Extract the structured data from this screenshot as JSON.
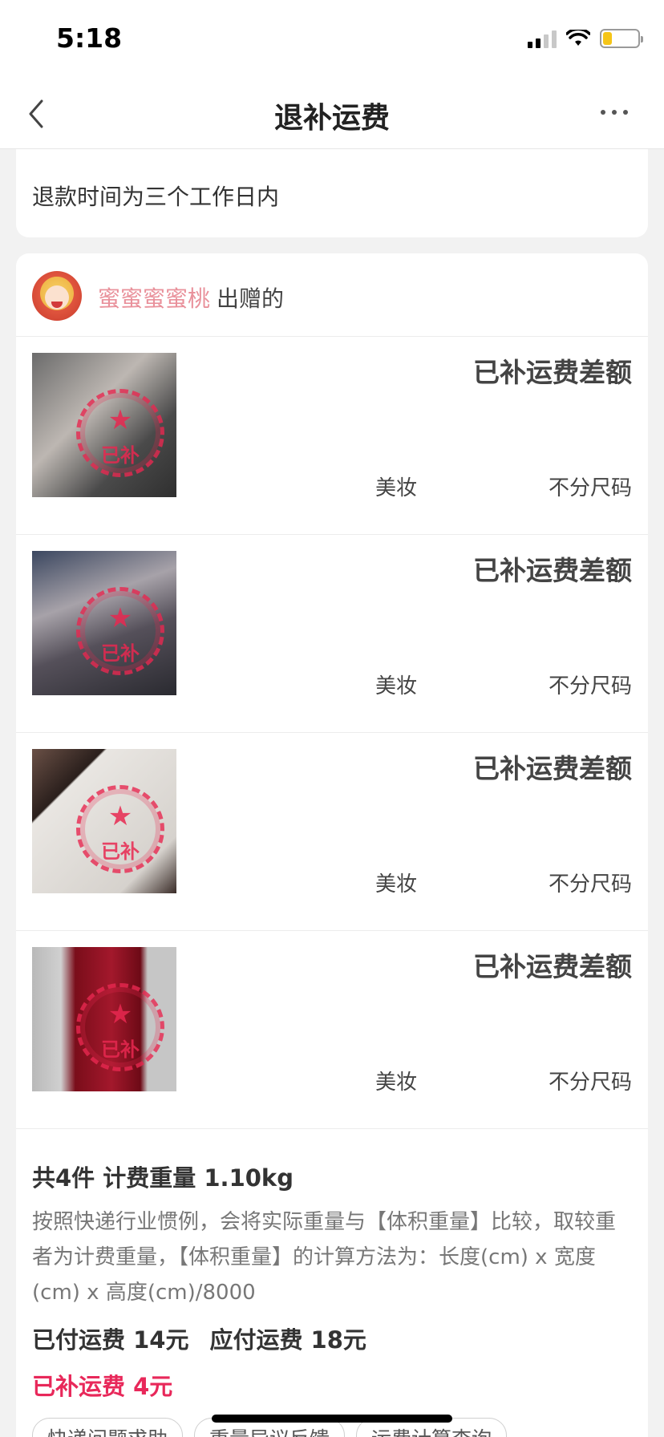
{
  "status_bar": {
    "time": "5:18",
    "battery_level": 0.25,
    "battery_color": "#f5c518"
  },
  "nav": {
    "title": "退补运费",
    "back_icon": "chevron-left-icon",
    "more_icon": "more-horizontal-icon"
  },
  "refund_note": "退款时间为三个工作日内",
  "giver": {
    "name": "蜜蜜蜜蜜桃",
    "suffix": "出赠的"
  },
  "items": [
    {
      "status": "已补运费差额",
      "category": "美妆",
      "size": "不分尺码",
      "stamp": "已补"
    },
    {
      "status": "已补运费差额",
      "category": "美妆",
      "size": "不分尺码",
      "stamp": "已补"
    },
    {
      "status": "已补运费差额",
      "category": "美妆",
      "size": "不分尺码",
      "stamp": "已补"
    },
    {
      "status": "已补运费差额",
      "category": "美妆",
      "size": "不分尺码",
      "stamp": "已补"
    }
  ],
  "summary": {
    "title": "共4件 计费重量 1.10kg",
    "description": "按照快递行业惯例，会将实际重量与【体积重量】比较，取较重者为计费重量，【体积重量】的计算方法为：长度(cm) x 宽度(cm) x 高度(cm)/8000",
    "paid_fee": "已付运费 14元",
    "due_fee": "应付运费 18元",
    "extra_fee": "已补运费 4元",
    "accent_color": "#e8285a"
  },
  "tags": [
    "快递问题求助",
    "重量异议反馈",
    "运费计算查询"
  ]
}
